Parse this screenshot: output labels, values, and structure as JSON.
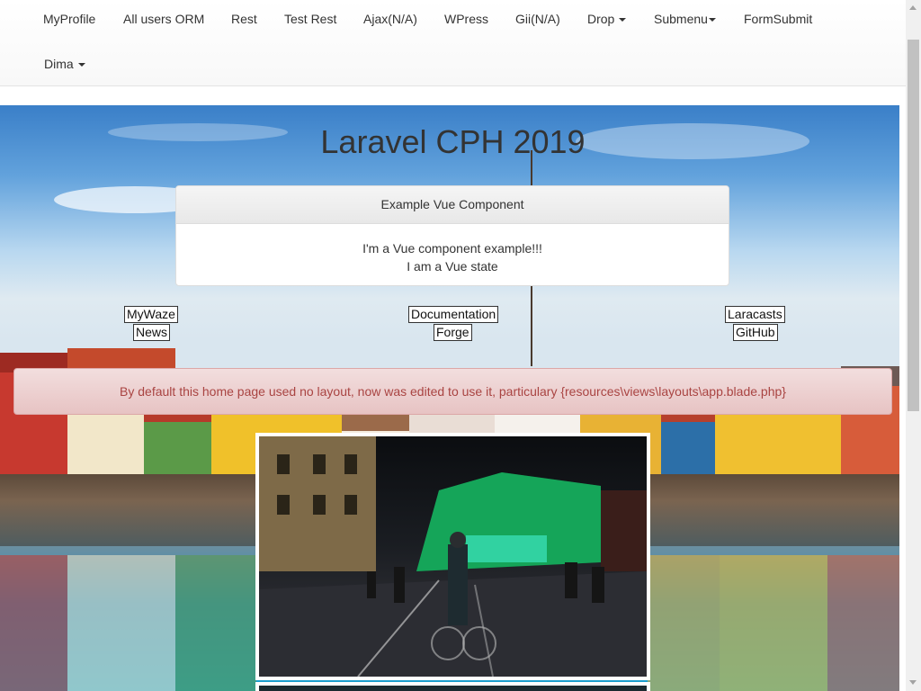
{
  "navbar": {
    "items": [
      {
        "label": "MyProfile"
      },
      {
        "label": "All users ORM"
      },
      {
        "label": "Rest"
      },
      {
        "label": "Test Rest"
      },
      {
        "label": "Ajax(N/A)"
      },
      {
        "label": "WPress"
      },
      {
        "label": "Gii(N/A)"
      },
      {
        "label": "Drop",
        "dropdown": true
      },
      {
        "label": "Submenu",
        "dropdown": true
      },
      {
        "label": "FormSubmit"
      },
      {
        "label": "Dima",
        "dropdown": true
      }
    ]
  },
  "hero": {
    "title": "Laravel CPH 2019"
  },
  "vue_panel": {
    "heading": "Example Vue Component",
    "line1": "I'm a Vue component example!!!",
    "line2": "I am a Vue state"
  },
  "links": {
    "mywaze": "MyWaze",
    "news": "News",
    "documentation": "Documentation",
    "forge": "Forge",
    "laracasts": "Laracasts",
    "github": "GitHub"
  },
  "alert": {
    "text": "By default this home page used no layout, now was edited to use it, particulary {resources\\views\\layouts\\app.blade.php}"
  },
  "colors": {
    "alert_text": "#a94442",
    "alert_bg": "#f2dede",
    "nav_text": "#333333",
    "title_text": "#333333"
  }
}
